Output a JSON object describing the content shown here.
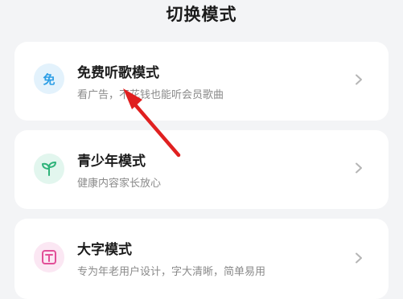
{
  "page_title": "切换模式",
  "modes": [
    {
      "icon": "free-icon",
      "icon_text": "免",
      "title": "免费听歌模式",
      "subtitle": "看广告，不花钱也能听会员歌曲",
      "accent": "#2c9ee6"
    },
    {
      "icon": "sprout-icon",
      "title": "青少年模式",
      "subtitle": "健康内容家长放心",
      "accent": "#2fb37a"
    },
    {
      "icon": "text-size-icon",
      "title": "大字模式",
      "subtitle": "专为年老用户设计，字大清晰，简单易用",
      "accent": "#e24f98"
    }
  ],
  "annotation": {
    "type": "arrow",
    "color": "#e02020"
  }
}
